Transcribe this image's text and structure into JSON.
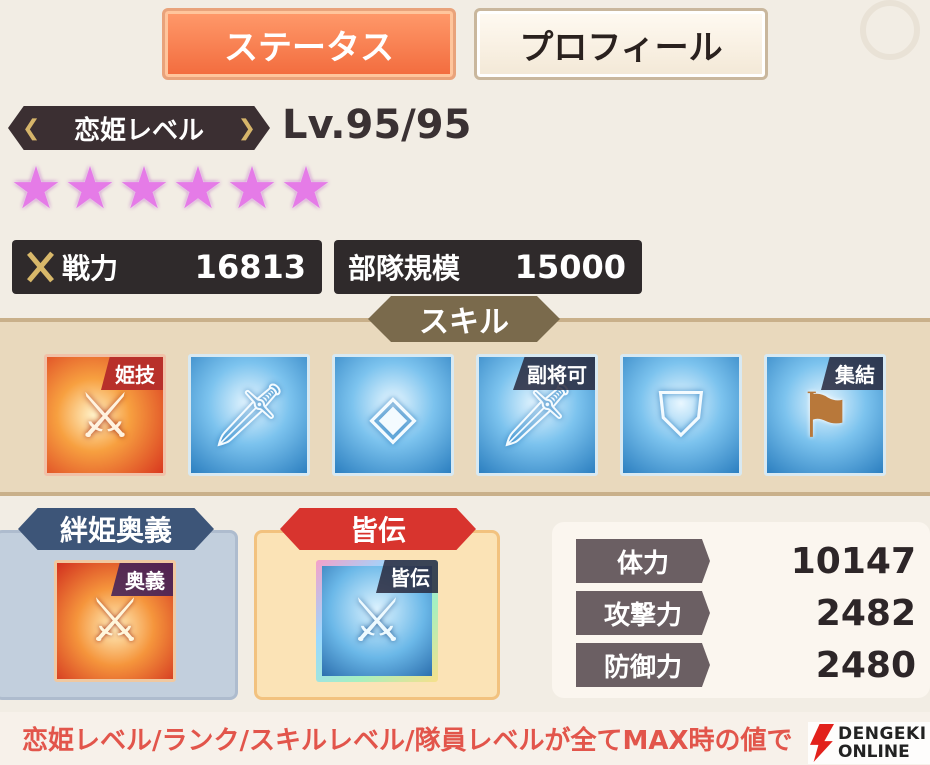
{
  "tabs": {
    "status": "ステータス",
    "profile": "プロフィール"
  },
  "level": {
    "label": "恋姫レベル",
    "value": "Lv.95/95",
    "stars": 6
  },
  "stats_top": {
    "power_label": "戦力",
    "power_value": "16813",
    "army_label": "部隊規模",
    "army_value": "15000"
  },
  "skills": {
    "title": "スキル",
    "items": [
      {
        "icon": "sword-slash-icon",
        "tag": "姫技"
      },
      {
        "icon": "sword-icon",
        "tag": ""
      },
      {
        "icon": "diamond-emblem-icon",
        "tag": ""
      },
      {
        "icon": "sword-wind-icon",
        "tag": "副将可"
      },
      {
        "icon": "shields-icon",
        "tag": ""
      },
      {
        "icon": "banner-flag-icon",
        "tag": "集結"
      }
    ]
  },
  "kizuna": {
    "title": "絆姫奥義",
    "tag": "奥義"
  },
  "minaden": {
    "title": "皆伝",
    "tag": "皆伝"
  },
  "stats": [
    {
      "label": "体力",
      "value": "10147"
    },
    {
      "label": "攻撃力",
      "value": "2482"
    },
    {
      "label": "防御力",
      "value": "2480"
    }
  ],
  "footer": {
    "note": "恋姫レベル/ランク/スキルレベル/隊員レベルが全てMAX時の値で",
    "logo_line1": "DENGEKI",
    "logo_line2": "ONLINE"
  },
  "colors": {
    "accent": "#f26b3d",
    "star": "#e57be7",
    "note": "#e2554b"
  }
}
